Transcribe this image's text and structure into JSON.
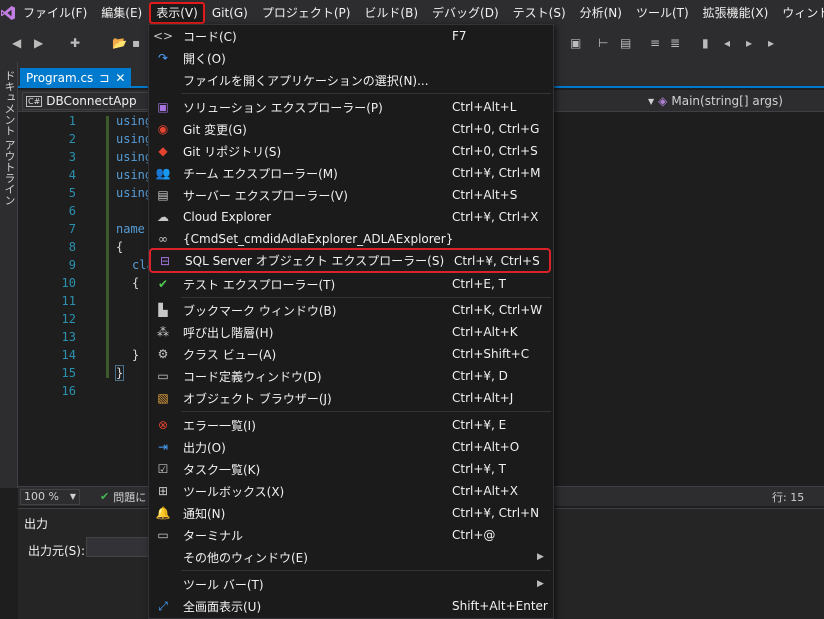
{
  "menubar": {
    "items": [
      "ファイル(F)",
      "編集(E)",
      "表示(V)",
      "Git(G)",
      "プロジェクト(P)",
      "ビルド(B)",
      "デバッグ(D)",
      "テスト(S)",
      "分析(N)",
      "ツール(T)",
      "拡張機能(X)",
      "ウィンドウ(W)"
    ]
  },
  "side_strip": {
    "label": "ドキュメント アウトライン"
  },
  "tab": {
    "file": "Program.cs",
    "pin": "⊐",
    "close": "✕"
  },
  "nav": {
    "project": "DBConnectApp",
    "cs_badge": "C#",
    "member": "Main(string[] args)"
  },
  "editor": {
    "line_numbers": [
      "1",
      "2",
      "3",
      "4",
      "5",
      "6",
      "7",
      "8",
      "9",
      "10",
      "11",
      "12",
      "13",
      "14",
      "15",
      "16"
    ],
    "code": {
      "l1": "using",
      "l2": "using",
      "l3": "using",
      "l4": "using",
      "l5": "using",
      "l7": "name",
      "l8": "{",
      "l9": "cla",
      "l10": "{",
      "l14": "}",
      "l15": "}"
    }
  },
  "status": {
    "zoom": "100 %",
    "issues": "問題に",
    "line_col": "行: 15"
  },
  "output": {
    "title": "出力",
    "source_label": "出力元(S):"
  },
  "view_menu": {
    "items": [
      {
        "label": "コード(C)",
        "shortcut": "F7",
        "icon": "code-icon"
      },
      {
        "label": "開く(O)",
        "shortcut": "",
        "icon": "open-arrow-icon"
      },
      {
        "label": "ファイルを開くアプリケーションの選択(N)...",
        "shortcut": "",
        "icon": ""
      },
      {
        "label": "ソリューション エクスプローラー(P)",
        "shortcut": "Ctrl+Alt+L",
        "icon": "solution-explorer-icon"
      },
      {
        "label": "Git 変更(G)",
        "shortcut": "Ctrl+0, Ctrl+G",
        "icon": "git-changes-icon"
      },
      {
        "label": "Git リポジトリ(S)",
        "shortcut": "Ctrl+0, Ctrl+S",
        "icon": "git-repository-icon"
      },
      {
        "label": "チーム エクスプローラー(M)",
        "shortcut": "Ctrl+¥, Ctrl+M",
        "icon": "team-explorer-icon"
      },
      {
        "label": "サーバー エクスプローラー(V)",
        "shortcut": "Ctrl+Alt+S",
        "icon": "server-explorer-icon"
      },
      {
        "label": "Cloud Explorer",
        "shortcut": "Ctrl+¥, Ctrl+X",
        "icon": "cloud-icon"
      },
      {
        "label": "{CmdSet_cmdidAdlaExplorer_ADLAExplorer}",
        "shortcut": "",
        "icon": "binoculars-icon"
      },
      {
        "label": "SQL Server オブジェクト エクスプローラー(S)",
        "shortcut": "Ctrl+¥, Ctrl+S",
        "icon": "sql-server-icon"
      },
      {
        "label": "テスト エクスプローラー(T)",
        "shortcut": "Ctrl+E, T",
        "icon": "test-explorer-icon"
      },
      {
        "label": "ブックマーク ウィンドウ(B)",
        "shortcut": "Ctrl+K, Ctrl+W",
        "icon": "bookmark-window-icon"
      },
      {
        "label": "呼び出し階層(H)",
        "shortcut": "Ctrl+Alt+K",
        "icon": "call-hierarchy-icon"
      },
      {
        "label": "クラス ビュー(A)",
        "shortcut": "Ctrl+Shift+C",
        "icon": "class-view-icon"
      },
      {
        "label": "コード定義ウィンドウ(D)",
        "shortcut": "Ctrl+¥, D",
        "icon": "code-definition-icon"
      },
      {
        "label": "オブジェクト ブラウザー(J)",
        "shortcut": "Ctrl+Alt+J",
        "icon": "object-browser-icon"
      },
      {
        "label": "エラー一覧(I)",
        "shortcut": "Ctrl+¥, E",
        "icon": "error-list-icon"
      },
      {
        "label": "出力(O)",
        "shortcut": "Ctrl+Alt+O",
        "icon": "output-icon"
      },
      {
        "label": "タスク一覧(K)",
        "shortcut": "Ctrl+¥, T",
        "icon": "task-list-icon"
      },
      {
        "label": "ツールボックス(X)",
        "shortcut": "Ctrl+Alt+X",
        "icon": "toolbox-icon"
      },
      {
        "label": "通知(N)",
        "shortcut": "Ctrl+¥, Ctrl+N",
        "icon": "bell-icon"
      },
      {
        "label": "ターミナル",
        "shortcut": "Ctrl+@",
        "icon": "terminal-icon"
      },
      {
        "label": "その他のウィンドウ(E)",
        "shortcut": "",
        "icon": ""
      },
      {
        "label": "ツール バー(T)",
        "shortcut": "",
        "icon": ""
      },
      {
        "label": "全画面表示(U)",
        "shortcut": "Shift+Alt+Enter",
        "icon": "full-screen-icon"
      }
    ]
  },
  "colors": {
    "accent": "#007acc",
    "highlight_border": "#d9222a",
    "menu_bg": "#1b1b1c"
  }
}
